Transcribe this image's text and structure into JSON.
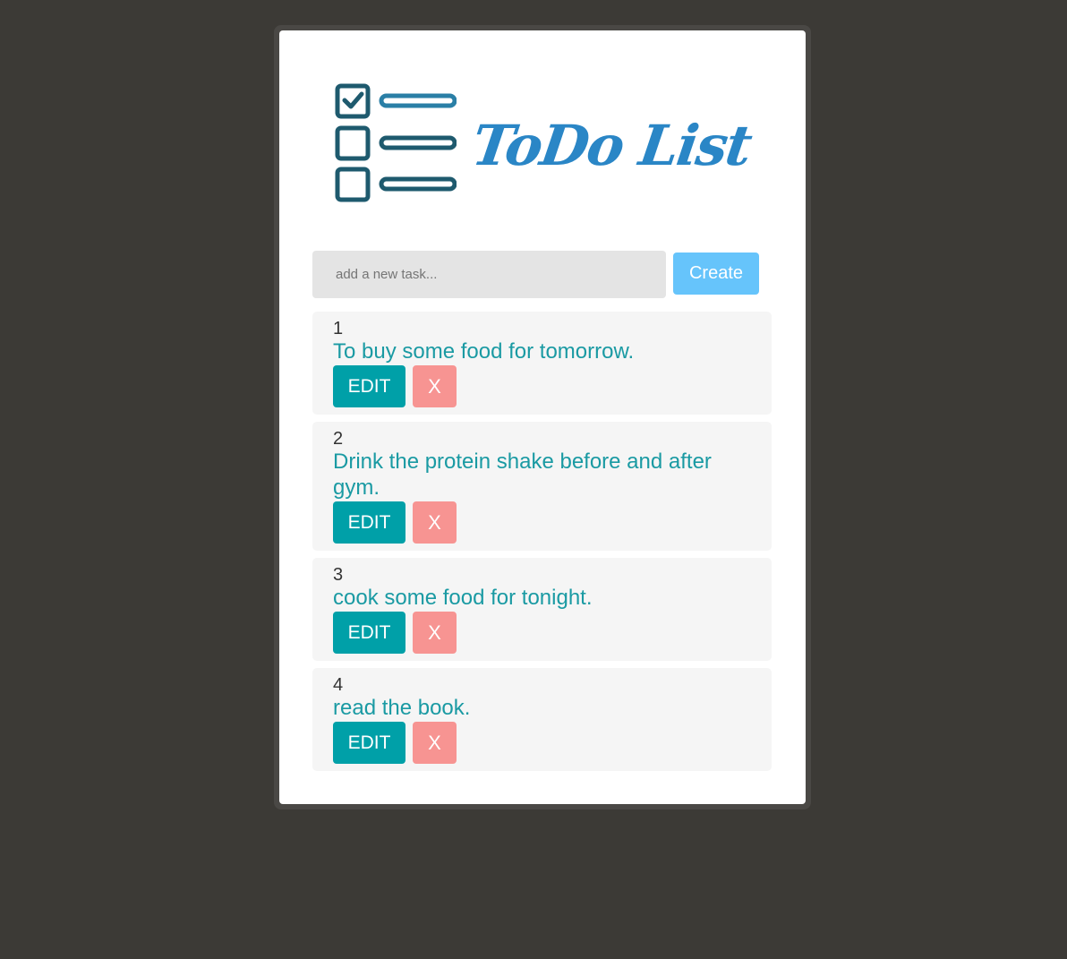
{
  "logo": {
    "text": "ToDo List",
    "icon": "checklist-icon",
    "colors": {
      "icon": "#1e5a6e",
      "text": "#2a86c6"
    }
  },
  "form": {
    "input_value": "",
    "input_placeholder": "add a new task...",
    "create_label": "Create"
  },
  "todos": [
    {
      "number": "1",
      "text": "To buy some food for tomorrow.",
      "edit_label": "EDIT",
      "delete_label": "X"
    },
    {
      "number": "2",
      "text": "Drink the protein shake before and after gym.",
      "edit_label": "EDIT",
      "delete_label": "X"
    },
    {
      "number": "3",
      "text": "cook some food for tonight.",
      "edit_label": "EDIT",
      "delete_label": "X"
    },
    {
      "number": "4",
      "text": "read the book.",
      "edit_label": "EDIT",
      "delete_label": "X"
    }
  ],
  "colors": {
    "background": "#3c3a36",
    "card": "#ffffff",
    "create_button": "#66c4fb",
    "edit_button": "#00a0a8",
    "delete_button": "#f79492",
    "task_text": "#1a9aa3",
    "item_background": "#f5f5f5"
  }
}
